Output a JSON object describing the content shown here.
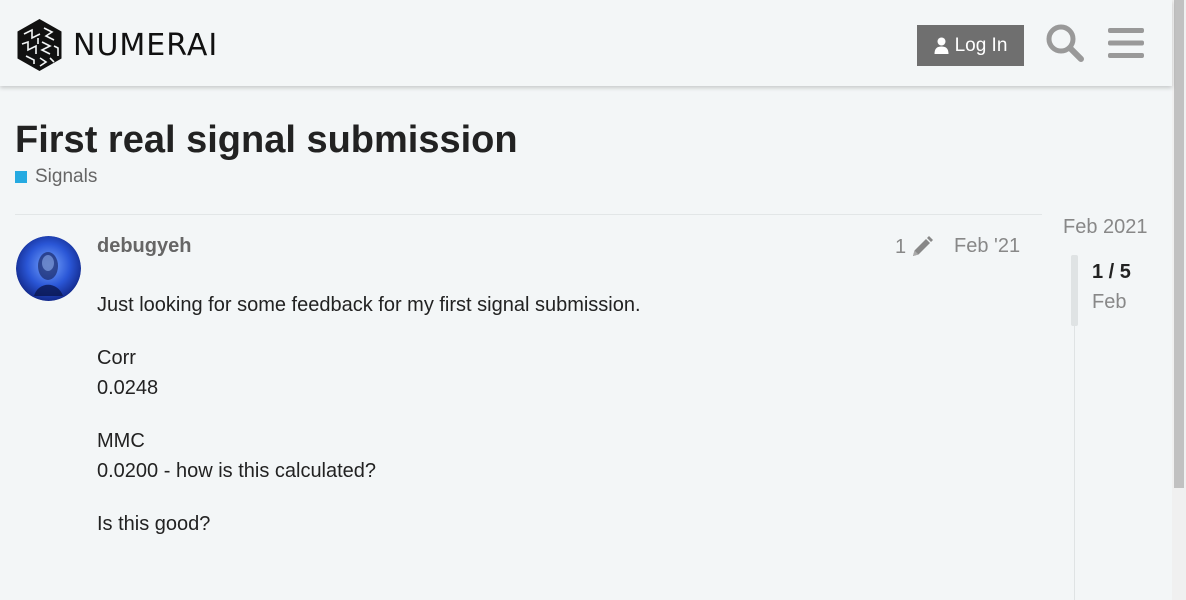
{
  "header": {
    "logo_text": "NUMERAI",
    "login_label": "Log In"
  },
  "topic": {
    "title": "First real signal submission",
    "category": "Signals",
    "category_color": "#25aae1"
  },
  "post": {
    "username": "debugyeh",
    "edit_count": "1",
    "date": "Feb '21",
    "paragraphs": [
      [
        "Just looking for some feedback for my first signal submission."
      ],
      [
        "Corr",
        "0.0248"
      ],
      [
        "MMC",
        "0.0200 - how is this calculated?"
      ],
      [
        "Is this good?"
      ]
    ]
  },
  "timeline": {
    "start_date": "Feb 2021",
    "position": "1 / 5",
    "current_date": "Feb"
  },
  "icons": {
    "logo": "numerai-cube-logo",
    "login": "user-icon",
    "search": "search-icon",
    "menu": "hamburger-menu-icon",
    "edit": "pencil-icon"
  }
}
